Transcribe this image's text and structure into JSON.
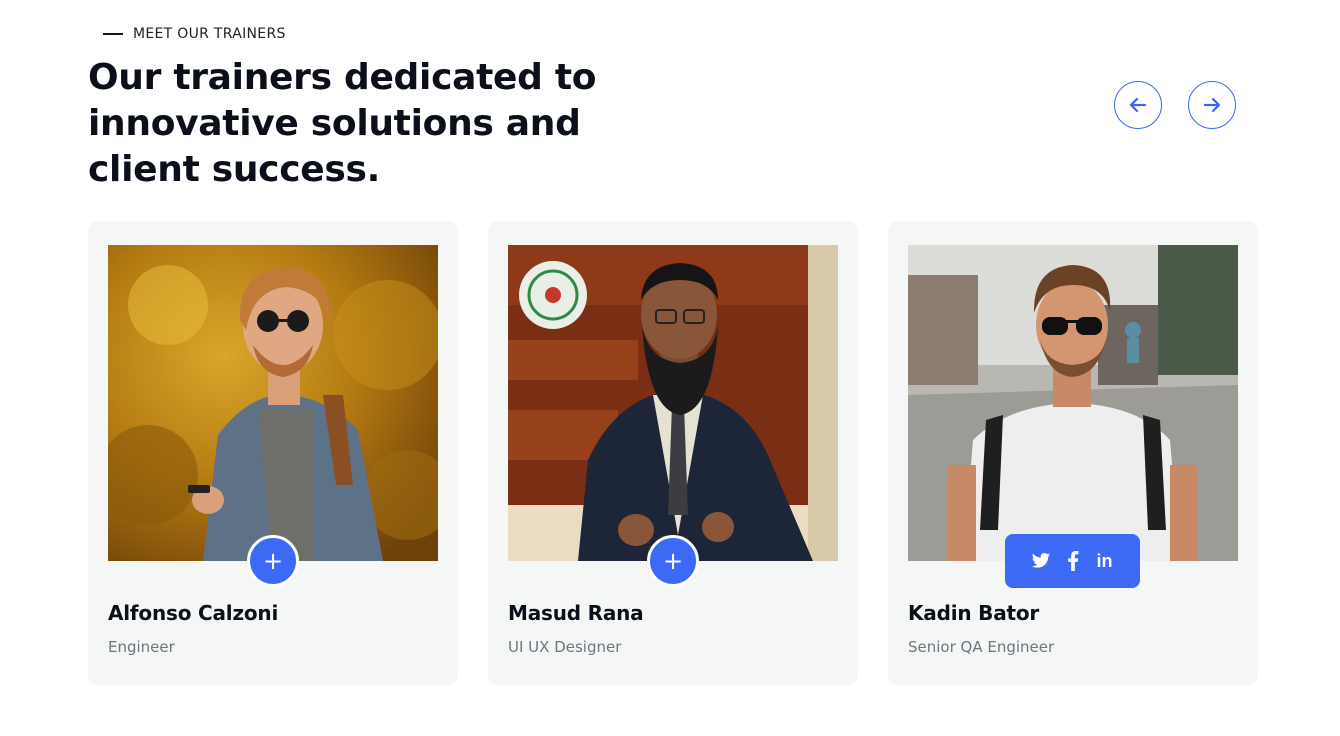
{
  "section": {
    "eyebrow": "MEET OUR TRAINERS",
    "headline": "Our trainers dedicated to innovative solutions and client success."
  },
  "navigation": {
    "prev_icon": "arrow-left-icon",
    "next_icon": "arrow-right-icon"
  },
  "trainers": [
    {
      "name": "Alfonso Calzoni",
      "role": "Engineer",
      "action_icon": "+"
    },
    {
      "name": "Masud Rana",
      "role": "UI UX Designer",
      "action_icon": "+"
    },
    {
      "name": "Kadin Bator",
      "role": "Senior QA Engineer",
      "social": {
        "twitter_icon": "twitter-icon",
        "facebook_icon": "facebook-icon",
        "linkedin_label": "in"
      }
    }
  ],
  "colors": {
    "accent": "#3c6af5",
    "card_bg": "#f5f6f6",
    "heading": "#0b0f1a",
    "muted": "#707680"
  }
}
